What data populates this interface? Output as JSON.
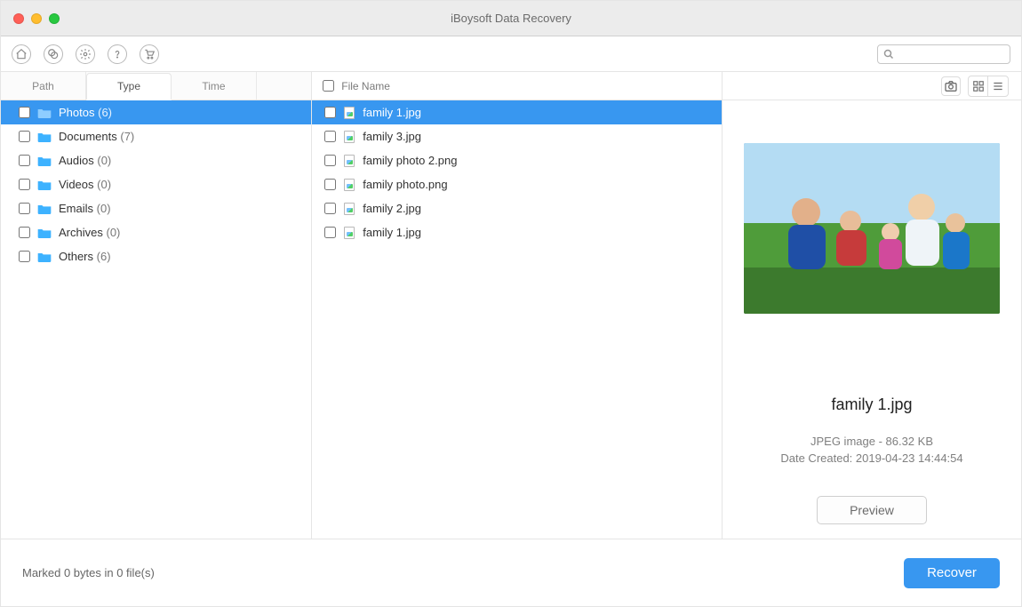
{
  "app": {
    "title": "iBoysoft Data Recovery"
  },
  "search": {
    "placeholder": ""
  },
  "tabs": [
    {
      "label": "Path"
    },
    {
      "label": "Type"
    },
    {
      "label": "Time"
    }
  ],
  "categories": [
    {
      "name": "Photos",
      "count": "(6)"
    },
    {
      "name": "Documents",
      "count": "(7)"
    },
    {
      "name": "Audios",
      "count": "(0)"
    },
    {
      "name": "Videos",
      "count": "(0)"
    },
    {
      "name": "Emails",
      "count": "(0)"
    },
    {
      "name": "Archives",
      "count": "(0)"
    },
    {
      "name": "Others",
      "count": "(6)"
    }
  ],
  "filelist": {
    "header": "File Name",
    "items": [
      {
        "name": "family 1.jpg"
      },
      {
        "name": "family 3.jpg"
      },
      {
        "name": "family photo 2.png"
      },
      {
        "name": "family photo.png"
      },
      {
        "name": "family 2.jpg"
      },
      {
        "name": "family 1.jpg"
      }
    ]
  },
  "preview": {
    "filename": "family 1.jpg",
    "meta1": "JPEG image - 86.32 KB",
    "meta2": "Date Created: 2019-04-23 14:44:54",
    "button": "Preview"
  },
  "footer": {
    "status": "Marked 0 bytes in 0 file(s)",
    "recover": "Recover"
  },
  "colors": {
    "accent": "#3897f0"
  }
}
